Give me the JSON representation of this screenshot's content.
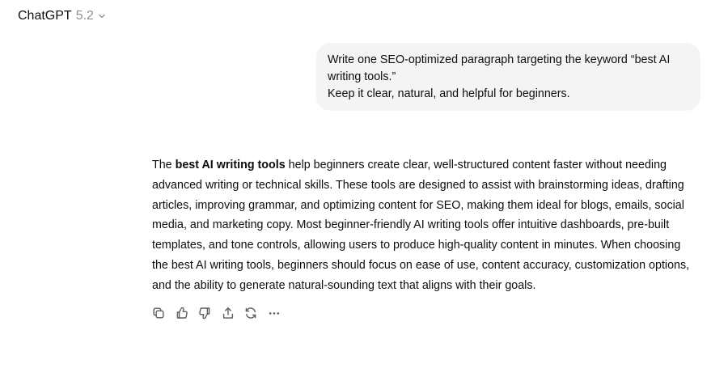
{
  "header": {
    "app_name": "ChatGPT",
    "model_version": "5.2",
    "dropdown_icon": "chevron-down-icon"
  },
  "user_message": {
    "lines": [
      "Write one SEO-optimized paragraph targeting the keyword “best AI",
      "writing tools.”",
      "Keep it clear, natural, and helpful for beginners."
    ]
  },
  "assistant_message": {
    "line_1_prefix": "The ",
    "line_1_bold": "best AI writing tools",
    "line_1_suffix": " help beginners create clear, well-structured content faster without needing",
    "lines": [
      "advanced writing or technical skills. These tools are designed to assist with brainstorming ideas, drafting",
      "articles, improving grammar, and optimizing content for SEO, making them ideal for blogs, emails, social",
      "media, and marketing copy. Most beginner-friendly AI writing tools offer intuitive dashboards, pre-built",
      "templates, and tone controls, allowing users to produce high-quality content in minutes. When choosing",
      "the best AI writing tools, beginners should focus on ease of use, content accuracy, customization options,",
      "and the ability to generate natural-sounding text that aligns with their goals."
    ]
  },
  "actions": [
    {
      "icon": "copy-icon"
    },
    {
      "icon": "thumbs-up-icon"
    },
    {
      "icon": "thumbs-down-icon"
    },
    {
      "icon": "share-icon"
    },
    {
      "icon": "regenerate-icon"
    },
    {
      "icon": "more-icon"
    }
  ]
}
